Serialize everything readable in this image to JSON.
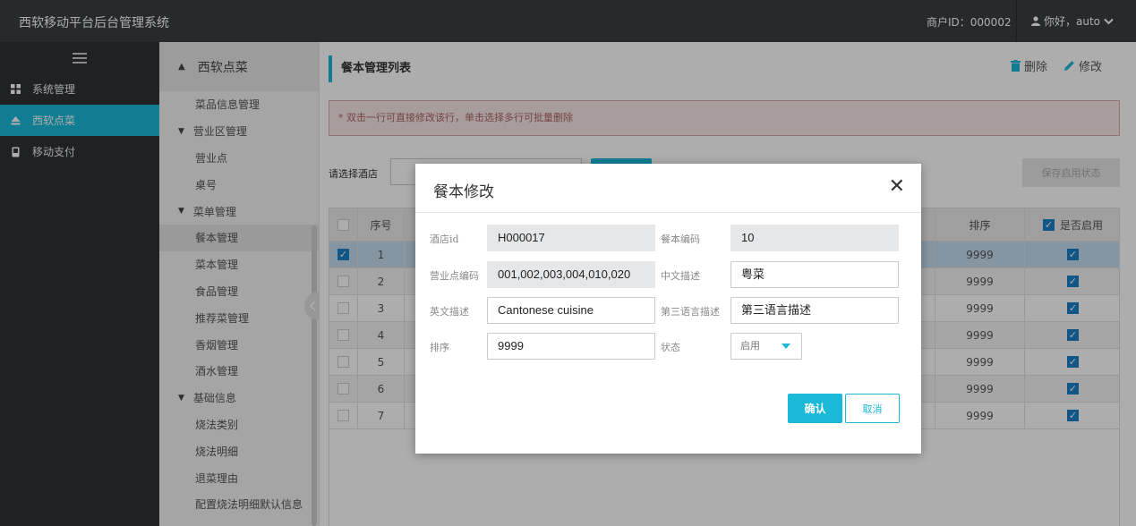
{
  "topbar": {
    "brand": "西软移动平台后台管理系统",
    "merchant_id": "商户ID：000002",
    "user_greeting": "你好，auto",
    "user_icon": "user-icon",
    "dropdown_icon": "chevron-down-icon"
  },
  "sidebar": {
    "menu_icon": "hamburger-icon",
    "items": [
      {
        "label": "系统管理",
        "icon": "grid-icon"
      },
      {
        "label": "西软点菜",
        "icon": "eject-icon",
        "active": true
      },
      {
        "label": "移动支付",
        "icon": "card-icon"
      }
    ]
  },
  "subnav": {
    "title": "西软点菜",
    "rows": [
      {
        "label": "菜品信息管理",
        "type": "child"
      },
      {
        "label": "营业区管理",
        "type": "group"
      },
      {
        "label": "营业点",
        "type": "child"
      },
      {
        "label": "桌号",
        "type": "child"
      },
      {
        "label": "菜单管理",
        "type": "group"
      },
      {
        "label": "餐本管理",
        "type": "child",
        "selected": true
      },
      {
        "label": "菜本管理",
        "type": "child"
      },
      {
        "label": "食品管理",
        "type": "child"
      },
      {
        "label": "推荐菜管理",
        "type": "child"
      },
      {
        "label": "香烟管理",
        "type": "child"
      },
      {
        "label": "酒水管理",
        "type": "child"
      },
      {
        "label": "基础信息",
        "type": "group"
      },
      {
        "label": "烧法类别",
        "type": "child"
      },
      {
        "label": "烧法明细",
        "type": "child"
      },
      {
        "label": "退菜理由",
        "type": "child"
      },
      {
        "label": "配置烧法明细默认信息",
        "type": "child"
      }
    ]
  },
  "main": {
    "title": "餐本管理列表",
    "delete_label": "删除",
    "edit_label": "修改",
    "notice": "* 双击一行可直接修改该行，单击选择多行可批量删除",
    "filter_label": "请选择酒店",
    "save_status_label": "保存启用状态",
    "table": {
      "headers": {
        "no": "序号",
        "sort": "排序",
        "enabled": "是否启用"
      },
      "rows": [
        {
          "no": "1",
          "sort": "9999",
          "checked": true,
          "enabled": true
        },
        {
          "no": "2",
          "sort": "9999",
          "checked": false,
          "enabled": true
        },
        {
          "no": "3",
          "sort": "9999",
          "checked": false,
          "enabled": true
        },
        {
          "no": "4",
          "sort": "9999",
          "checked": false,
          "enabled": true
        },
        {
          "no": "5",
          "sort": "9999",
          "checked": false,
          "enabled": true
        },
        {
          "no": "6",
          "sort": "9999",
          "checked": false,
          "enabled": true
        },
        {
          "no": "7",
          "sort": "9999",
          "checked": false,
          "enabled": true
        }
      ]
    }
  },
  "modal": {
    "title": "餐本修改",
    "fields": {
      "hotel_id_label": "酒店id",
      "hotel_id_value": "H000017",
      "menu_code_label": "餐本编码",
      "menu_code_value": "10",
      "outlet_code_label": "营业点编码",
      "outlet_code_value": "001,002,003,004,010,020",
      "cn_desc_label": "中文描述",
      "cn_desc_value": "粤菜",
      "en_desc_label": "英文描述",
      "en_desc_value": "Cantonese cuisine",
      "third_desc_label": "第三语言描述",
      "third_desc_value": "第三语言描述",
      "sort_label": "排序",
      "sort_value": "9999",
      "status_label": "状态",
      "status_value": "启用"
    },
    "confirm_label": "确认",
    "cancel_label": "取消"
  },
  "colors": {
    "accent": "#1ab9d8",
    "topbar": "#3a3d42",
    "sidebar": "#2f3237",
    "checkbox": "#1a7fc7"
  }
}
